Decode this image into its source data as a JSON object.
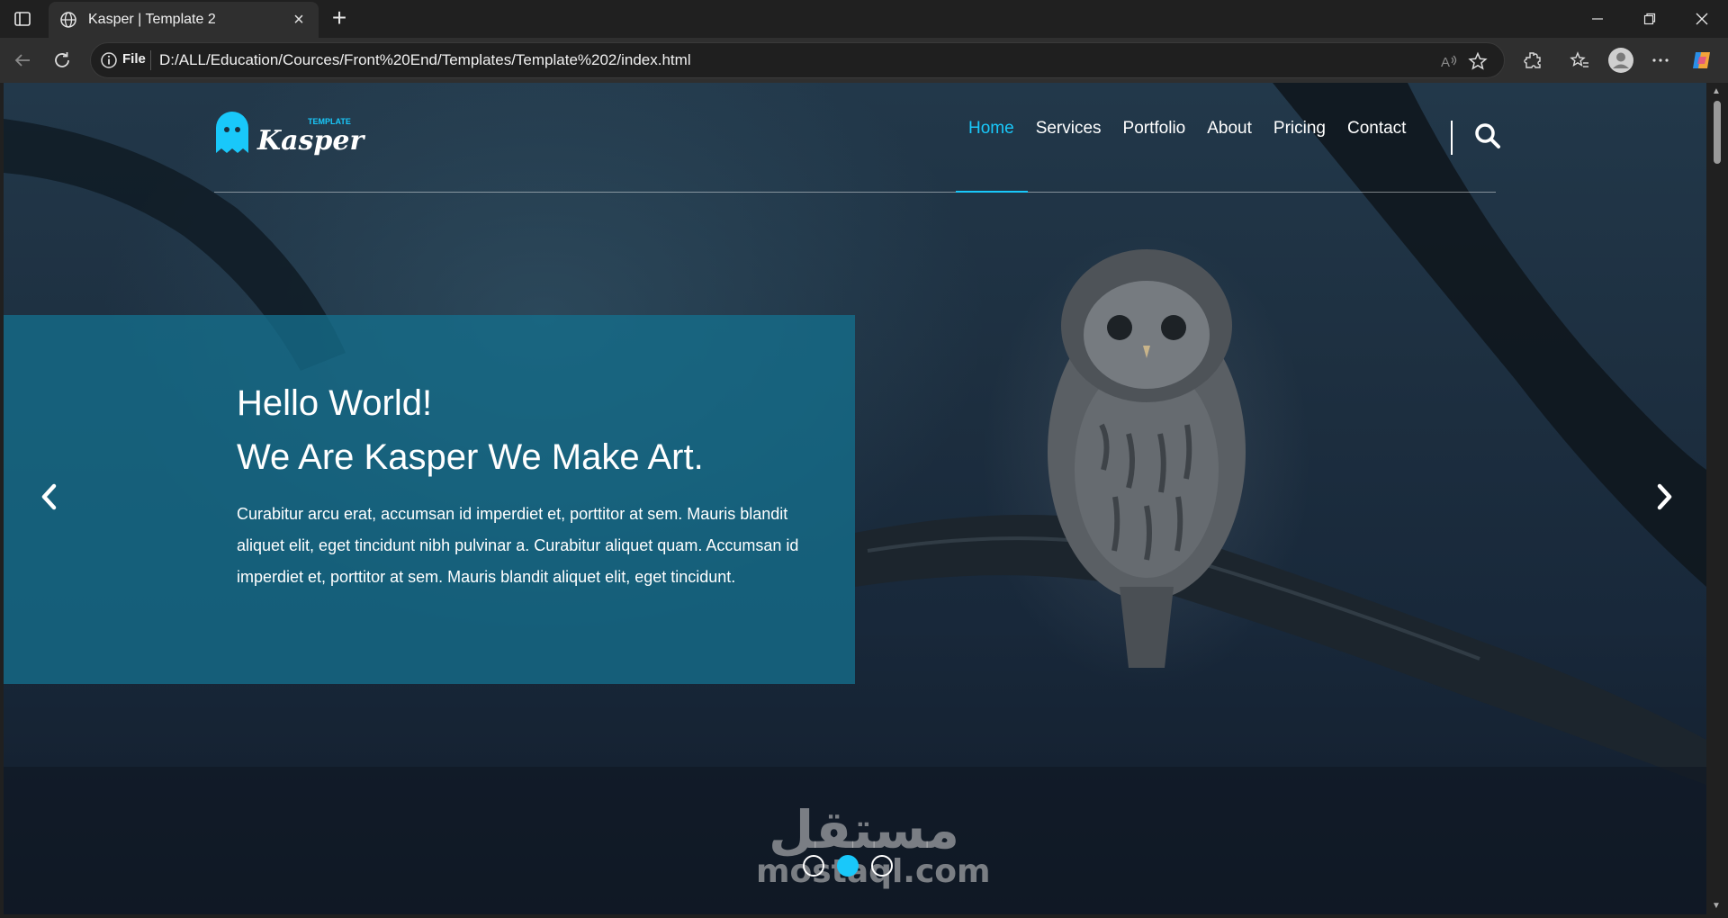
{
  "browser": {
    "tab_title": "Kasper | Template 2",
    "address_scheme_label": "File",
    "url": "D:/ALL/Education/Cources/Front%20End/Templates/Template%202/index.html"
  },
  "site": {
    "logo_small": "TEMPLATE",
    "logo_main": "Kasper",
    "nav": [
      {
        "label": "Home",
        "active": true
      },
      {
        "label": "Services",
        "active": false
      },
      {
        "label": "Portfolio",
        "active": false
      },
      {
        "label": "About",
        "active": false
      },
      {
        "label": "Pricing",
        "active": false
      },
      {
        "label": "Contact",
        "active": false
      }
    ],
    "accent_color": "#19c8fa"
  },
  "hero": {
    "title_line1": "Hello World!",
    "title_line2": "We Are Kasper We Make Art.",
    "text": "Curabitur arcu erat, accumsan id imperdiet et, porttitor at sem. Mauris blandit aliquet elit, eget tincidunt nibh pulvinar a. Curabitur aliquet quam. Accumsan id imperdiet et, porttitor at sem. Mauris blandit aliquet elit, eget tincidunt.",
    "slides_count": 3,
    "active_slide": 2
  },
  "watermark": {
    "arabic": "مستقل",
    "latin": "mostaql.com"
  }
}
